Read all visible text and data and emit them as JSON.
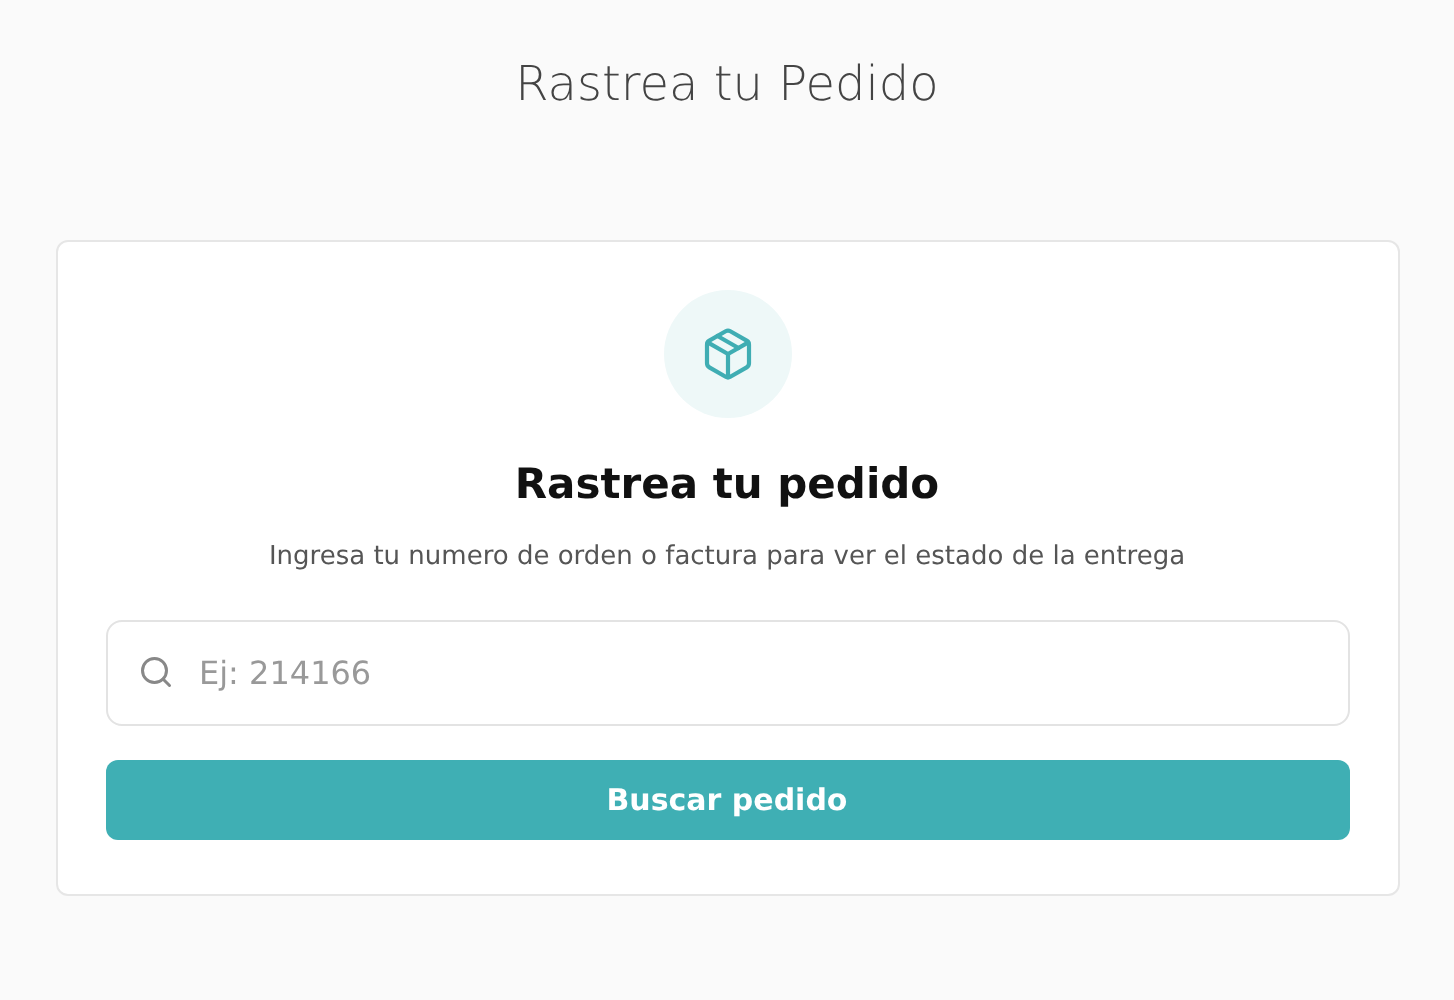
{
  "page_title": "Rastrea tu Pedido",
  "card": {
    "heading": "Rastrea tu pedido",
    "description": "Ingresa tu numero de orden o factura para ver el estado de la entrega",
    "search": {
      "placeholder": "Ej: 214166"
    },
    "button": "Buscar pedido"
  }
}
